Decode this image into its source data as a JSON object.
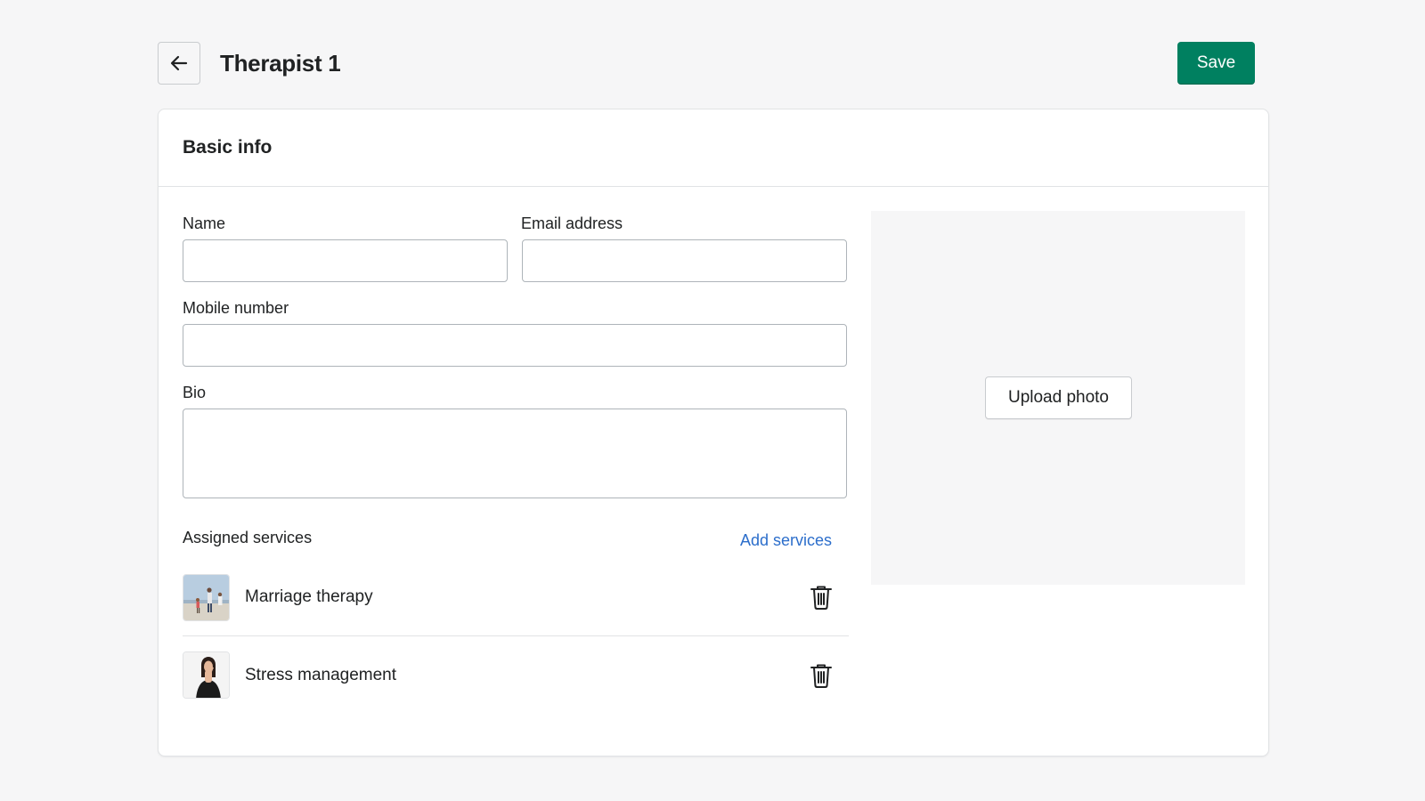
{
  "header": {
    "back_icon": "arrow-left-icon",
    "title": "Therapist 1",
    "save_label": "Save",
    "save_color": "#008060"
  },
  "card": {
    "title": "Basic info",
    "fields": {
      "name_label": "Name",
      "name_value": "",
      "email_label": "Email address",
      "email_value": "",
      "mobile_label": "Mobile number",
      "mobile_value": "",
      "bio_label": "Bio",
      "bio_value": ""
    },
    "photo": {
      "upload_label": "Upload photo"
    },
    "services": {
      "label": "Assigned services",
      "add_label": "Add services",
      "link_color": "#2c6ecb",
      "items": [
        {
          "name": "Marriage therapy",
          "thumbnail": "family-beach-photo",
          "remove_icon": "trash-icon"
        },
        {
          "name": "Stress management",
          "thumbnail": "stressed-woman-photo",
          "remove_icon": "trash-icon"
        }
      ]
    }
  }
}
